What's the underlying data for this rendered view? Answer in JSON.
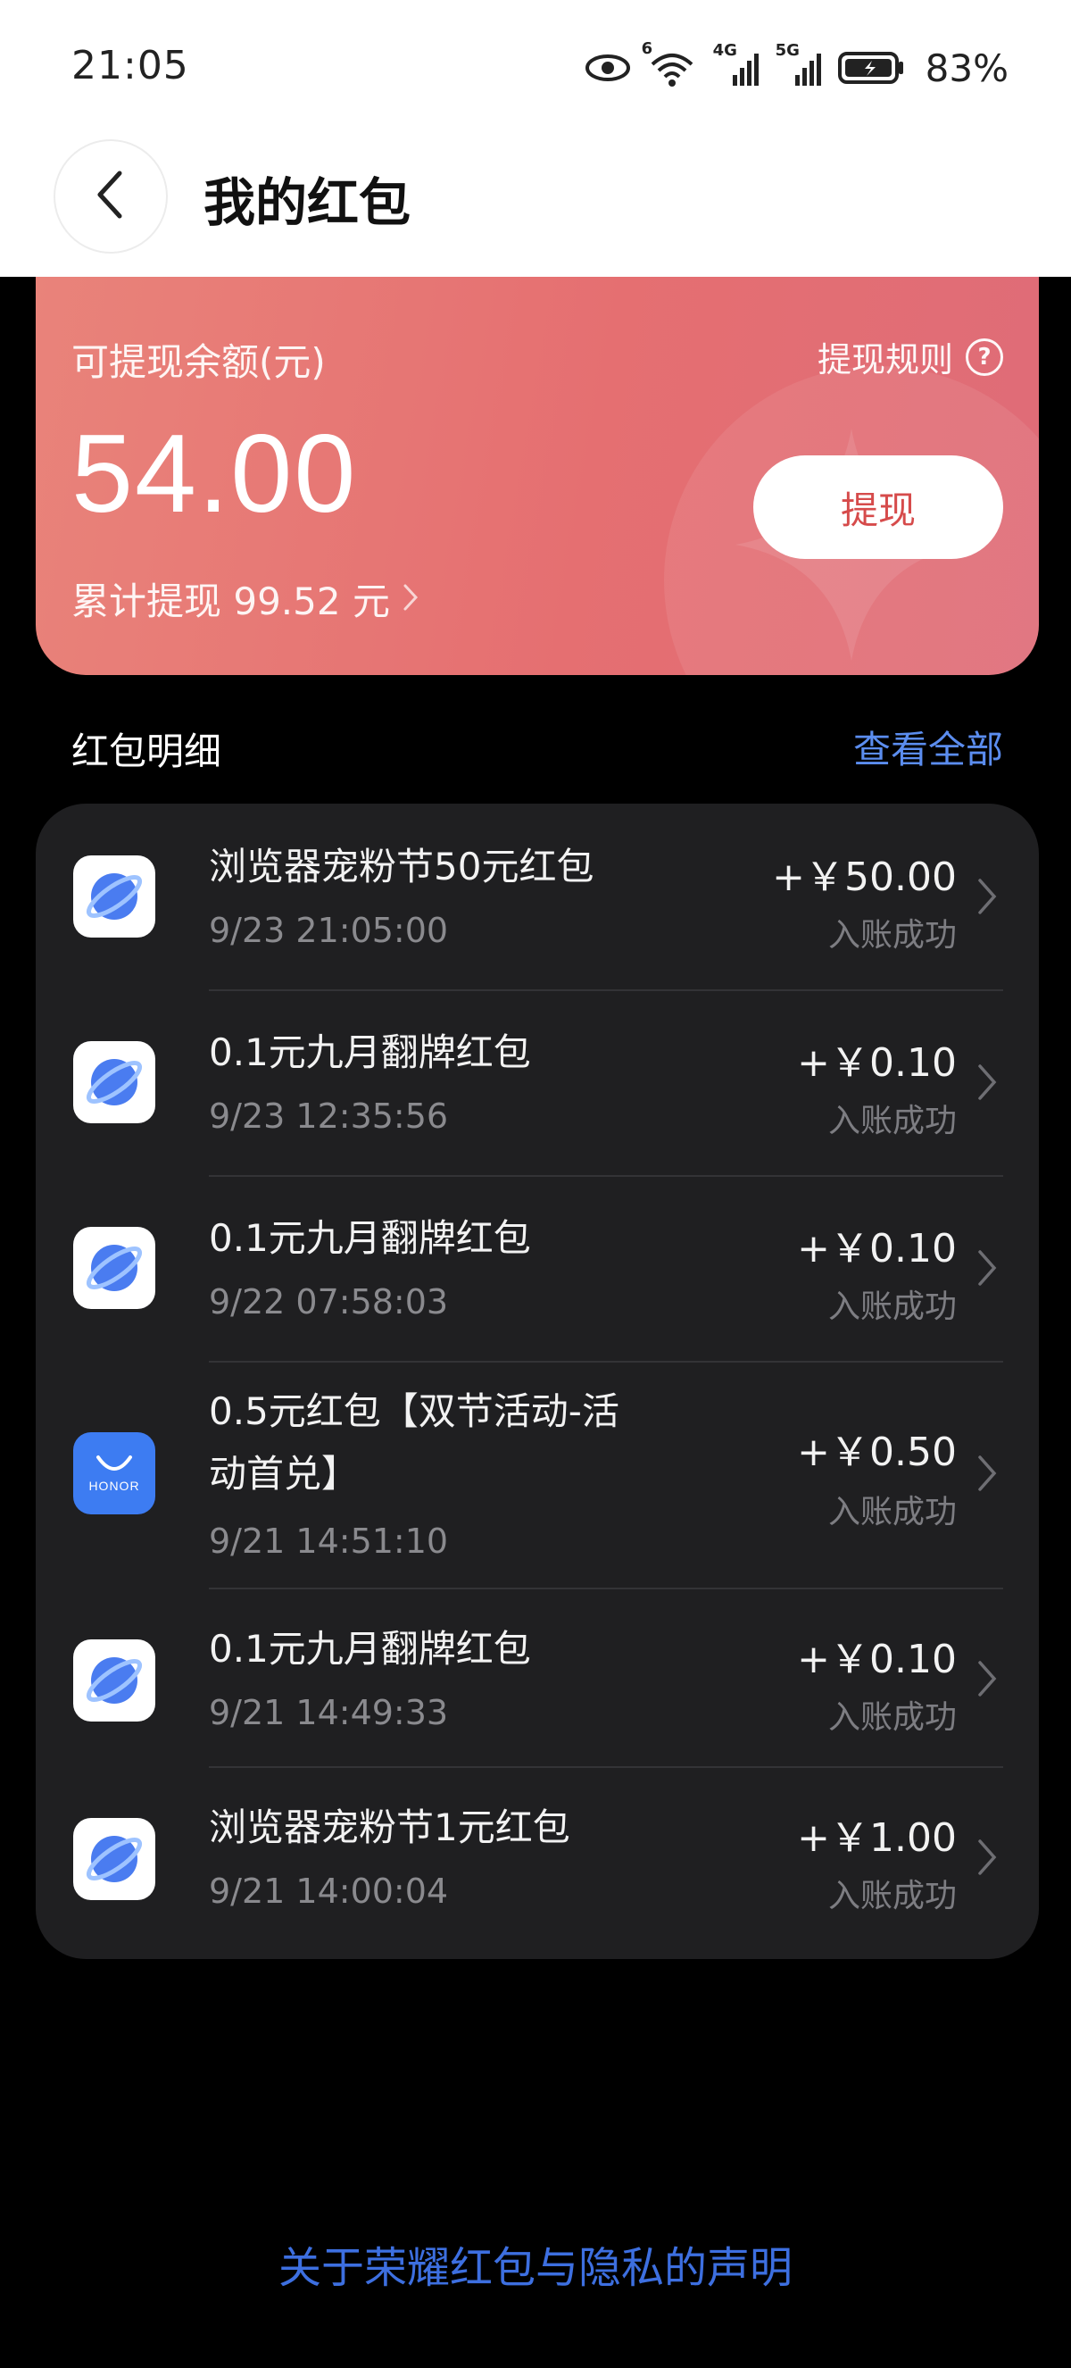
{
  "status_bar": {
    "time": "21:05",
    "wifi_badge": "6",
    "net1": "4G",
    "net2": "5G",
    "battery": "83%"
  },
  "header": {
    "title": "我的红包"
  },
  "balance": {
    "label": "可提现余额(元)",
    "rules": "提现规则",
    "amount": "54.00",
    "total_withdrawn": "累计提现 99.52 元",
    "withdraw_button": "提现"
  },
  "section": {
    "title": "红包明细",
    "view_all": "查看全部"
  },
  "items": [
    {
      "title": "浏览器宠粉节50元红包",
      "time": "9/23 21:05:00",
      "amount": "+￥50.00",
      "status": "入账成功",
      "icon": "browser-icon"
    },
    {
      "title": "0.1元九月翻牌红包",
      "time": "9/23 12:35:56",
      "amount": "+￥0.10",
      "status": "入账成功",
      "icon": "browser-icon"
    },
    {
      "title": "0.1元九月翻牌红包",
      "time": "9/22 07:58:03",
      "amount": "+￥0.10",
      "status": "入账成功",
      "icon": "browser-icon"
    },
    {
      "title": "0.5元红包【双节活动-活动首兑】",
      "time": "9/21 14:51:10",
      "amount": "+￥0.50",
      "status": "入账成功",
      "icon": "honor-store-icon",
      "honor_label": "HONOR"
    },
    {
      "title": "0.1元九月翻牌红包",
      "time": "9/21 14:49:33",
      "amount": "+￥0.10",
      "status": "入账成功",
      "icon": "browser-icon"
    },
    {
      "title": "浏览器宠粉节1元红包",
      "time": "9/21 14:00:04",
      "amount": "+￥1.00",
      "status": "入账成功",
      "icon": "browser-icon"
    }
  ],
  "footer": {
    "link": "关于荣耀红包与隐私的声明"
  }
}
